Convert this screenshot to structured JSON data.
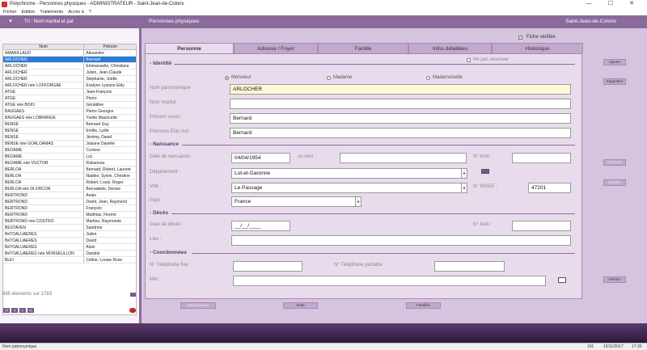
{
  "window": {
    "title": "Polychrome - Personnes physiques - ADMINISTRATEUR - Saint-Jean-de-Coloris",
    "minimize": "—",
    "maximize": "☐",
    "close": "✕"
  },
  "menu": [
    "Fichier",
    "Edition",
    "Traitements",
    "Accès à",
    "?"
  ],
  "header": {
    "sort_label": "Tri : Nom marital et pat",
    "title": "Personnes physiques",
    "city": "Saint-Jean-de-Coloris"
  },
  "list": {
    "columns": [
      "Nom",
      "Prénom"
    ],
    "rows": [
      [
        "AMARILLAUD",
        "Alexandre"
      ],
      [
        "ARLOCHER",
        "Bernard"
      ],
      [
        "ARLOCHER",
        "Emmanuelle, Christiane"
      ],
      [
        "ARLOCHER",
        "Julien, Jean-Claude"
      ],
      [
        "ARLOCHER",
        "Stéphanie, Joëlle"
      ],
      [
        "ARLOCHER née LOFFORGAE",
        "Evelyne Lysiane Eldy"
      ],
      [
        "ATGE",
        "Jean-François"
      ],
      [
        "ATGE",
        "Pierre"
      ],
      [
        "ATGE née BOIO",
        "Géraldine"
      ],
      [
        "BAUGAES",
        "Pierre Georges"
      ],
      [
        "BAUGAES née LOBRANUE",
        "Yvette Mauricette"
      ],
      [
        "BENSE",
        "Bernard Guy"
      ],
      [
        "BENSE",
        "Emilie, Lydie"
      ],
      [
        "BENSE",
        "Jérémy, David"
      ],
      [
        "BENSE née GOALOAMAS",
        "Josiane Danièle"
      ],
      [
        "BEOAME",
        "Corinne"
      ],
      [
        "BEOAME",
        "Luc"
      ],
      [
        "BEOAME née VUCTOR",
        "Raharisoa"
      ],
      [
        "BERLOA",
        "Bernard, Robert, Laurent"
      ],
      [
        "BERLOA",
        "Nadine, Sylvie, Christine"
      ],
      [
        "BERLOA",
        "Robert, Louis, Roger"
      ],
      [
        "BERLOA née OLORCON",
        "Bernadette, Denise"
      ],
      [
        "BERTROND",
        "Anais"
      ],
      [
        "BERTROND",
        "David, Jean, Raymond"
      ],
      [
        "BERTROND",
        "François"
      ],
      [
        "BERTROND",
        "Matthias, Florent"
      ],
      [
        "BERTROND née COSTRO",
        "Martine, Raymonde"
      ],
      [
        "BESTAVEN",
        "Sandrine"
      ],
      [
        "BéTOALUAERES",
        "Julien"
      ],
      [
        "BéTOALUAERES",
        "David"
      ],
      [
        "BéTOALUAERES",
        "Alain"
      ],
      [
        "BéTOALUAERES née MORSEULLON",
        "Danièle"
      ],
      [
        "BLEI",
        "Céline, Louise Rose"
      ]
    ],
    "selected_index": 1,
    "count_text": "695 éléments sur 1783"
  },
  "fiche_verifiee": "Fiche vérifiée",
  "tabs": [
    "Personne",
    "Adresse / Foyer",
    "Famille",
    "Infos détaillées",
    "Historique"
  ],
  "identite": {
    "heading": "- Identité",
    "ne_pas_recenser": "Ne pas recenser",
    "civilites": [
      "Monsieur",
      "Madame",
      "Mademoiselle"
    ],
    "civilite_selected": 0,
    "nom_patronymique_label": "Nom patronymique :",
    "nom_patronymique": "ARLOCHER",
    "nom_marital_label": "Nom marital :",
    "nom_marital": "",
    "prenom_usuel_label": "Prénom usuel :",
    "prenom_usuel": "Bernard",
    "prenoms_etat_civil_label": "Prénoms Etat civil :",
    "prenoms_etat_civil": "Bernard"
  },
  "naissance": {
    "heading": "- Naissance",
    "date_label": "Date de naissance :",
    "date": "04/04/1954",
    "ou_vers_label": "ou vers :",
    "ou_vers": "",
    "acte_label": "N° Acte :",
    "acte": "",
    "departement_label": "Département :",
    "departement": "Lot-et-Garonne",
    "ville_label": "Ville :",
    "ville": "Le Passage",
    "insee_label": "N° INSEE :",
    "insee": "47201",
    "pays_label": "Pays :",
    "pays": "France"
  },
  "deces": {
    "heading": "- Décès",
    "date_label": "Date de décès :",
    "date": "__/__/____",
    "acte_label": "N° Acte :",
    "acte": "",
    "lieu_label": "Lieu :",
    "lieu": ""
  },
  "coordonnees": {
    "heading": "- Coordonnées",
    "tel_fixe_label": "N° Téléphone fixe :",
    "tel_fixe": "",
    "tel_portable_label": "N° Téléphone portable :",
    "tel_portable": "",
    "mel_label": "Mél :",
    "mel": ""
  },
  "side_buttons": [
    "Ajouter",
    "Supprimer",
    "Imprimer",
    "Modifier",
    "Fermer"
  ],
  "bottom_buttons": [
    "Modifications",
    "Suite",
    "Familles"
  ],
  "status": {
    "field": "Nom patronymique",
    "num": "101",
    "date": "15/11/2017",
    "time": "17:30"
  }
}
